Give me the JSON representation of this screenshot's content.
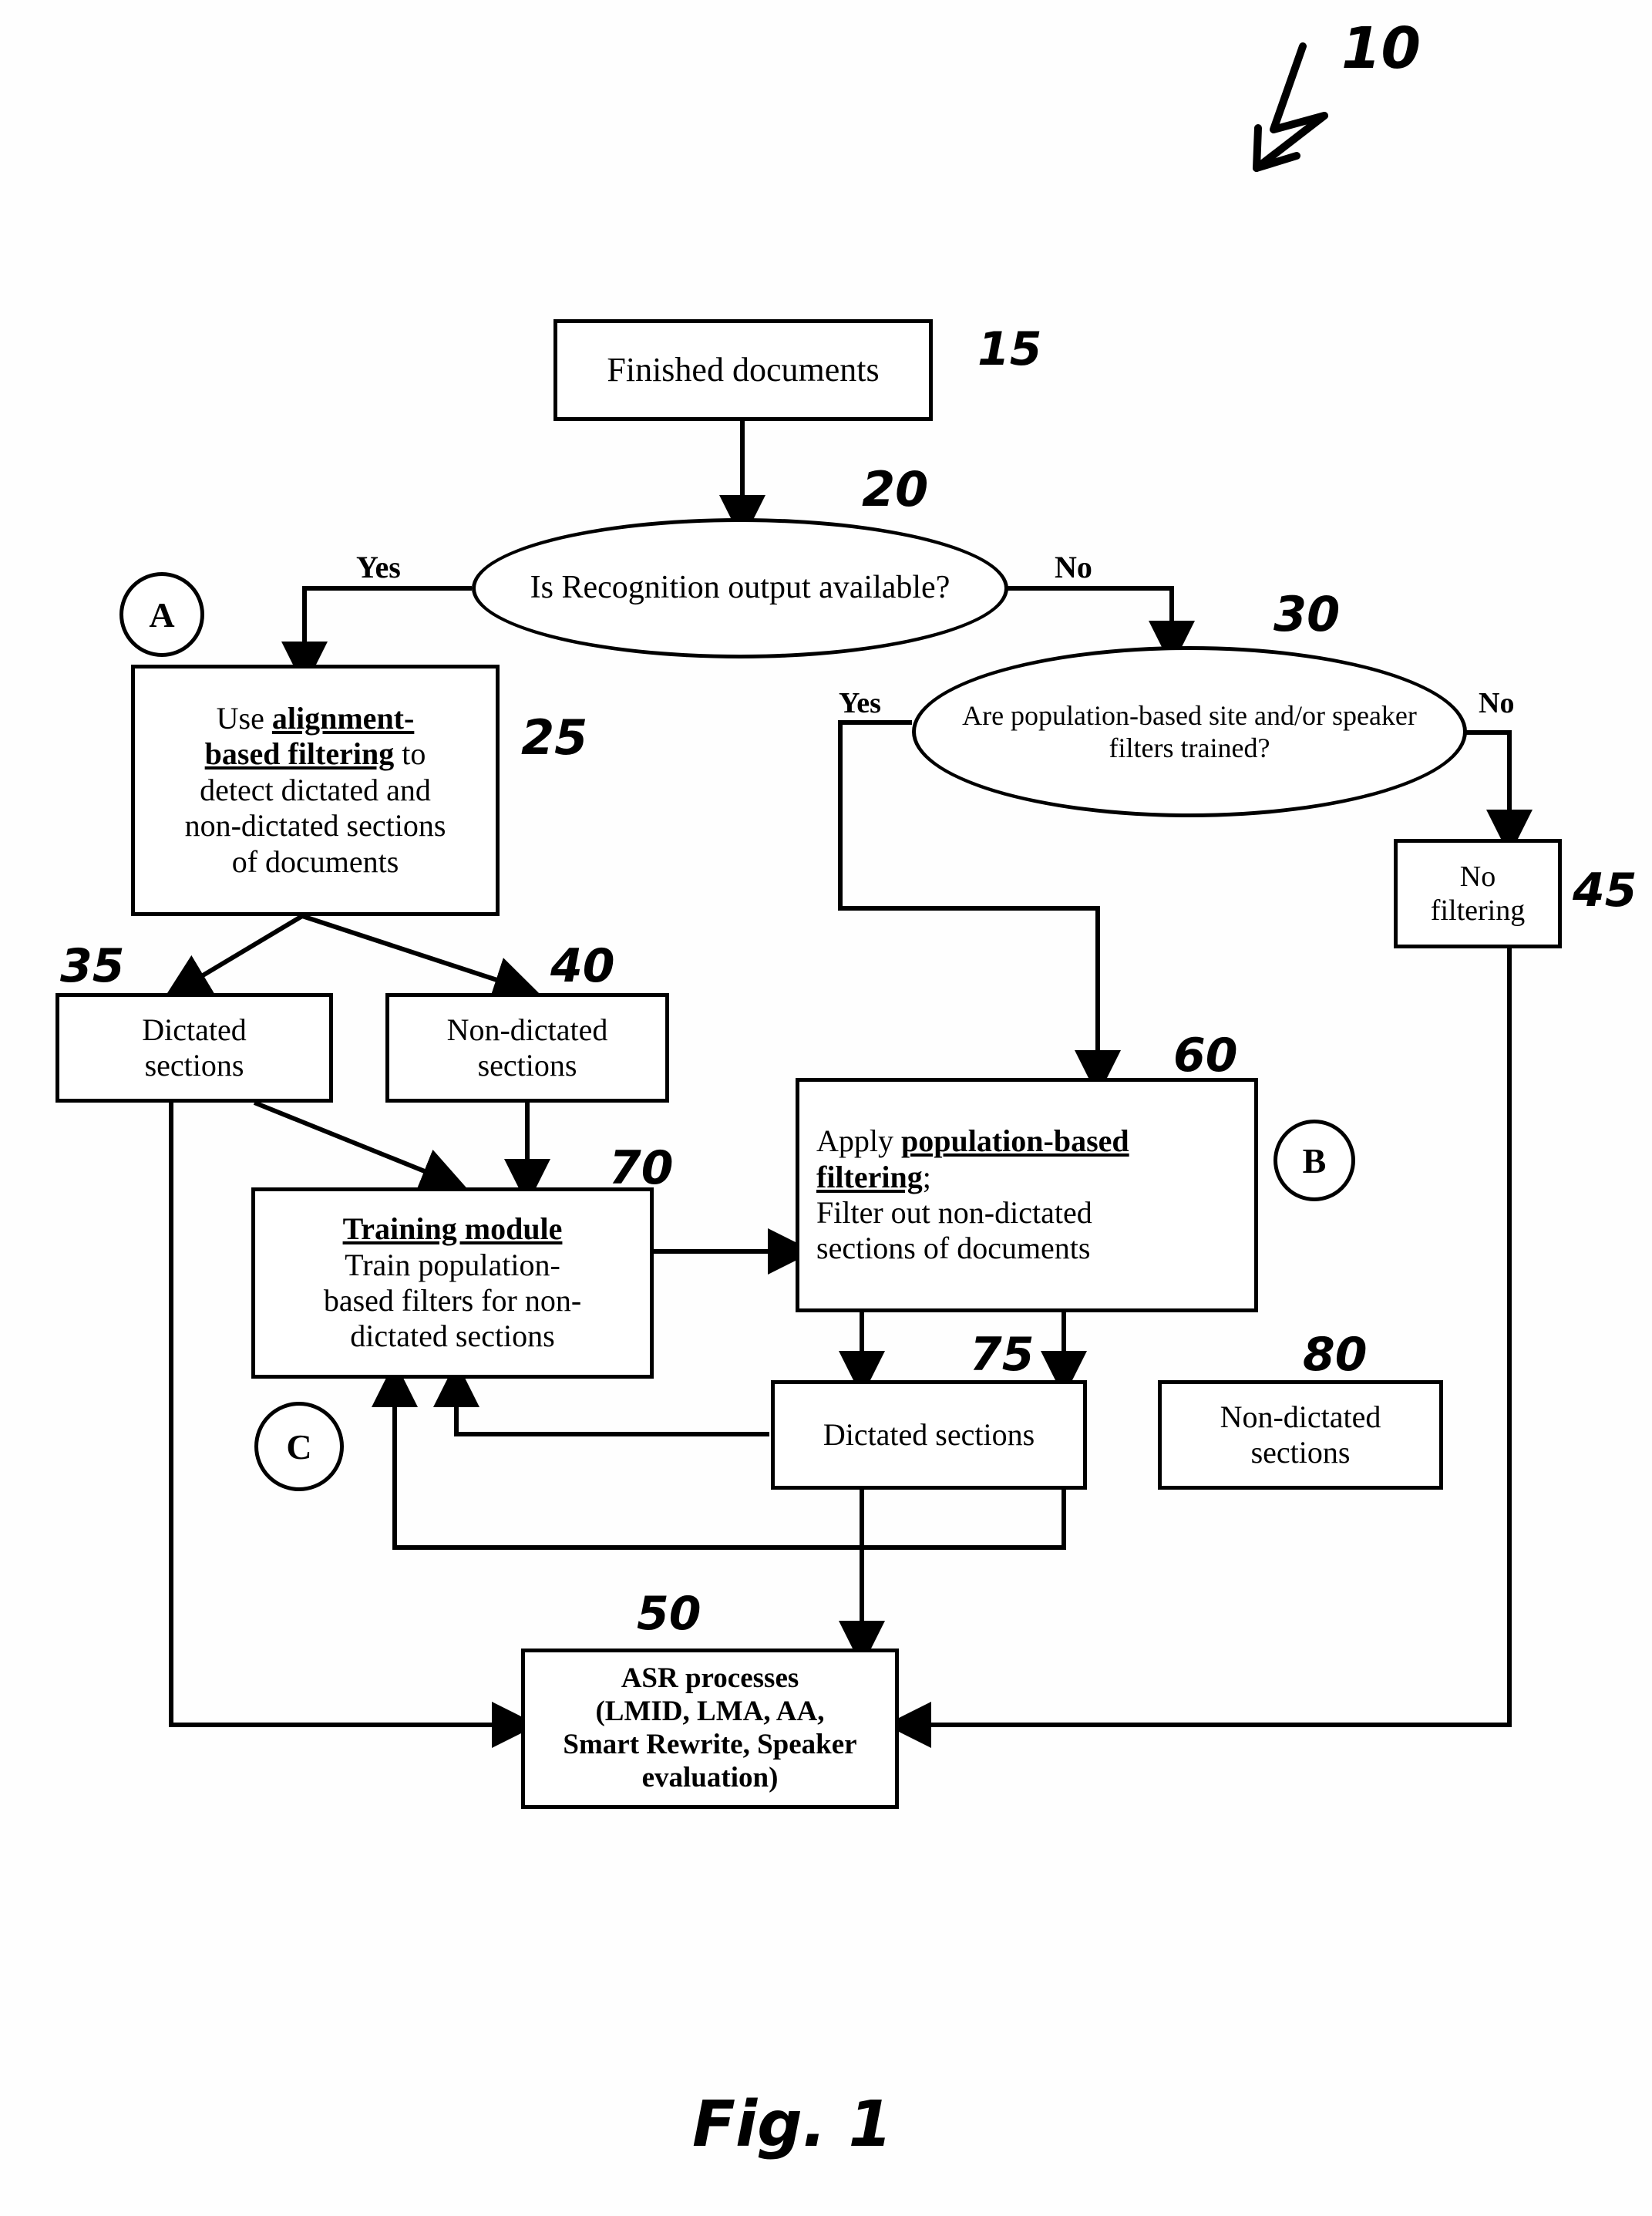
{
  "figure": {
    "caption": "Fig. 1",
    "system_ref": "10"
  },
  "nodes": {
    "finished_documents": {
      "label": "Finished documents",
      "ref": "15"
    },
    "q_recognition": {
      "label": "Is Recognition output available?",
      "ref": "20"
    },
    "alignment_filtering": {
      "line1_plain": "Use ",
      "line1_bold": "alignment-",
      "line2_bold": "based filtering",
      "line2_plain": " to",
      "line3": "detect dictated and",
      "line4": "non-dictated sections",
      "line5": "of documents",
      "ref": "25"
    },
    "q_population_filters": {
      "label": "Are population-based site and/or speaker filters trained?",
      "ref": "30"
    },
    "no_filtering": {
      "line1": "No",
      "line2": "filtering",
      "ref": "45"
    },
    "dictated_sections_a": {
      "line1": "Dictated",
      "line2": "sections",
      "ref": "35"
    },
    "non_dictated_sections_a": {
      "line1": "Non-dictated",
      "line2": "sections",
      "ref": "40"
    },
    "training_module": {
      "title": "Training module",
      "line2": "Train population-",
      "line3": "based filters for non-",
      "line4": "dictated sections",
      "ref": "70"
    },
    "population_filtering": {
      "line1_plain": "Apply ",
      "line1_bold": "population-based",
      "line2_bold": "filtering",
      "line2_plain": ";",
      "line3": "Filter out non-dictated",
      "line4": "sections of documents",
      "ref": "60"
    },
    "dictated_sections_b": {
      "label": "Dictated sections",
      "ref": "75"
    },
    "non_dictated_sections_b": {
      "line1": "Non-dictated",
      "line2": "sections",
      "ref": "80"
    },
    "asr_processes": {
      "line1": "ASR processes",
      "line2": "(LMID, LMA, AA,",
      "line3": "Smart Rewrite, Speaker",
      "line4": "evaluation)",
      "ref": "50"
    }
  },
  "connectors": {
    "yes_left": "Yes",
    "no_right": "No",
    "yes_second": "Yes",
    "no_second": "No"
  },
  "markers": {
    "a": "A",
    "b": "B",
    "c": "C"
  },
  "colors": {
    "ink": "#000000",
    "paper": "#ffffff"
  }
}
